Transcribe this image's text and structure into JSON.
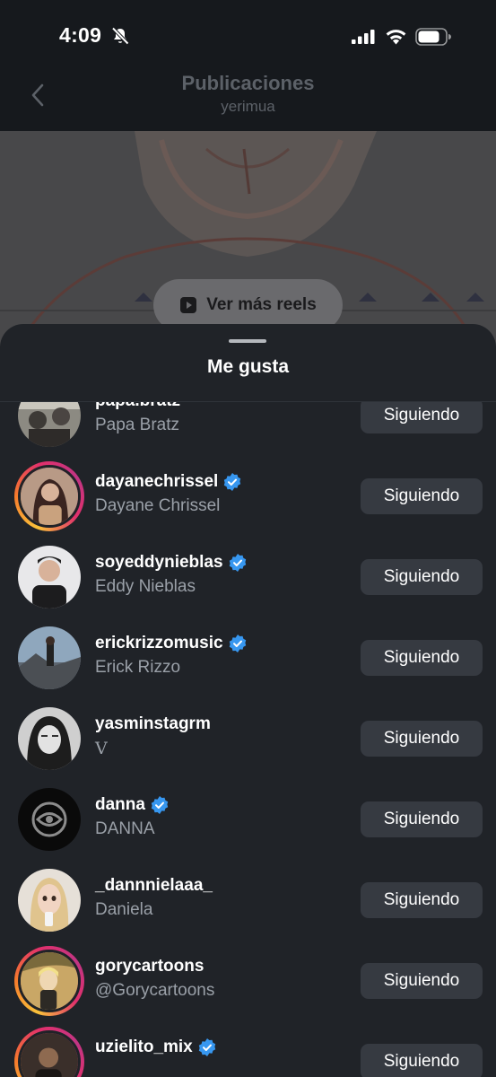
{
  "status_bar": {
    "time": "4:09"
  },
  "header": {
    "title": "Publicaciones",
    "subtitle": "yerimua"
  },
  "post": {
    "reels_button_label": "Ver más reels"
  },
  "sheet": {
    "title": "Me gusta",
    "users": [
      {
        "username": "papa.bratz",
        "full_name": "Papa Bratz",
        "verified": false,
        "story_ring": false,
        "button_label": "Siguiendo"
      },
      {
        "username": "dayanechrissel",
        "full_name": "Dayane Chrissel",
        "verified": true,
        "story_ring": true,
        "button_label": "Siguiendo"
      },
      {
        "username": "soyeddynieblas",
        "full_name": "Eddy Nieblas",
        "verified": true,
        "story_ring": false,
        "button_label": "Siguiendo"
      },
      {
        "username": "erickrizzomusic",
        "full_name": "Erick Rizzo",
        "verified": true,
        "story_ring": false,
        "button_label": "Siguiendo"
      },
      {
        "username": "yasminstagrm",
        "full_name": "V",
        "verified": false,
        "story_ring": false,
        "button_label": "Siguiendo"
      },
      {
        "username": "danna",
        "full_name": "DANNA",
        "verified": true,
        "story_ring": false,
        "button_label": "Siguiendo"
      },
      {
        "username": "_dannnielaaa_",
        "full_name": "Daniela",
        "verified": false,
        "story_ring": false,
        "button_label": "Siguiendo"
      },
      {
        "username": "gorycartoons",
        "full_name": "@Gorycartoons",
        "verified": false,
        "story_ring": true,
        "button_label": "Siguiendo"
      },
      {
        "username": "uzielito_mix",
        "full_name": "",
        "verified": true,
        "story_ring": true,
        "button_label": "Siguiendo"
      }
    ]
  },
  "colors": {
    "verified_blue": "#3797f0",
    "button_bg": "#363a41",
    "sheet_bg": "#202328"
  }
}
